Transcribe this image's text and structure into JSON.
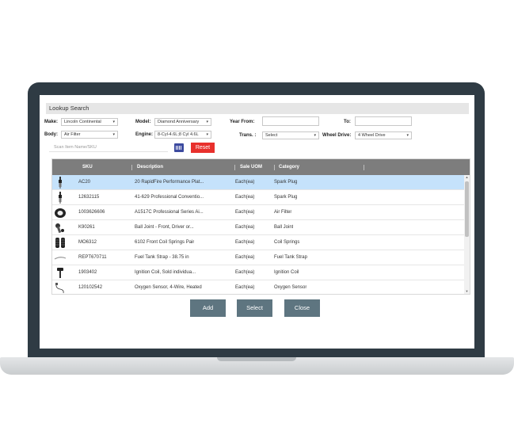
{
  "panel": {
    "title": "Lookup Search"
  },
  "filters": {
    "make": {
      "label": "Make:",
      "value": "Lincoln Continental"
    },
    "model": {
      "label": "Model:",
      "value": "Diamond Anniversary"
    },
    "year_from": {
      "label": "Year From:"
    },
    "year_to": {
      "label": "To:"
    },
    "body": {
      "label": "Body:",
      "value": "Air Filter"
    },
    "engine": {
      "label": "Engine:",
      "value": "8-Cyl-4.6L;8 Cyl 4.6L"
    },
    "trans": {
      "label": "Trans. :",
      "value": "Select"
    },
    "wheel_drive": {
      "label": "Wheel Drive:",
      "value": "4 Wheel Drive"
    },
    "search": {
      "placeholder": "Scan Item Name/SKU"
    },
    "reset_label": "Reset"
  },
  "table": {
    "columns": [
      "SKU",
      "Description",
      "Sale UOM",
      "Category"
    ],
    "rows": [
      {
        "sku": "AC20",
        "description": "20 RapidFire Performance Plat...",
        "uom": "Each(ea)",
        "category": "Spark Plug",
        "icon": "spark-plug-icon",
        "selected": true
      },
      {
        "sku": "12632115",
        "description": "41-629 Professional Conventio...",
        "uom": "Each(ea)",
        "category": "Spark Plug",
        "icon": "spark-plug-icon",
        "selected": false
      },
      {
        "sku": "1003626606",
        "description": "A1517C Professional Series Ai...",
        "uom": "Each(ea)",
        "category": "Air Filter",
        "icon": "air-filter-icon",
        "selected": false
      },
      {
        "sku": "K90261",
        "description": "Ball Joint - Front, Driver or...",
        "uom": "Each(ea)",
        "category": "Ball Joint",
        "icon": "ball-joint-icon",
        "selected": false
      },
      {
        "sku": "MO6312",
        "description": "6102 Front Coil Springs Pair",
        "uom": "Each(ea)",
        "category": "Coil Springs",
        "icon": "coil-spring-icon",
        "selected": false
      },
      {
        "sku": "REPT670711",
        "description": "Fuel Tank Strap - 38.75 in",
        "uom": "Each(ea)",
        "category": "Fuel Tank Strap",
        "icon": "fuel-tank-strap-icon",
        "selected": false
      },
      {
        "sku": "1903402",
        "description": "Ignition Coil, Sold individua...",
        "uom": "Each(ea)",
        "category": "Ignition Coil",
        "icon": "ignition-coil-icon",
        "selected": false
      },
      {
        "sku": "120102542",
        "description": "Oxygen Sensor, 4-Wire, Heated",
        "uom": "Each(ea)",
        "category": "Oxygen Sensor",
        "icon": "oxygen-sensor-icon",
        "selected": false
      }
    ]
  },
  "actions": {
    "add": "Add",
    "select": "Select",
    "close": "Close"
  },
  "colors": {
    "accent": "#5e7580",
    "reset": "#e8302c",
    "selected_row": "#c5e2fb",
    "header": "#7d7d7d"
  }
}
